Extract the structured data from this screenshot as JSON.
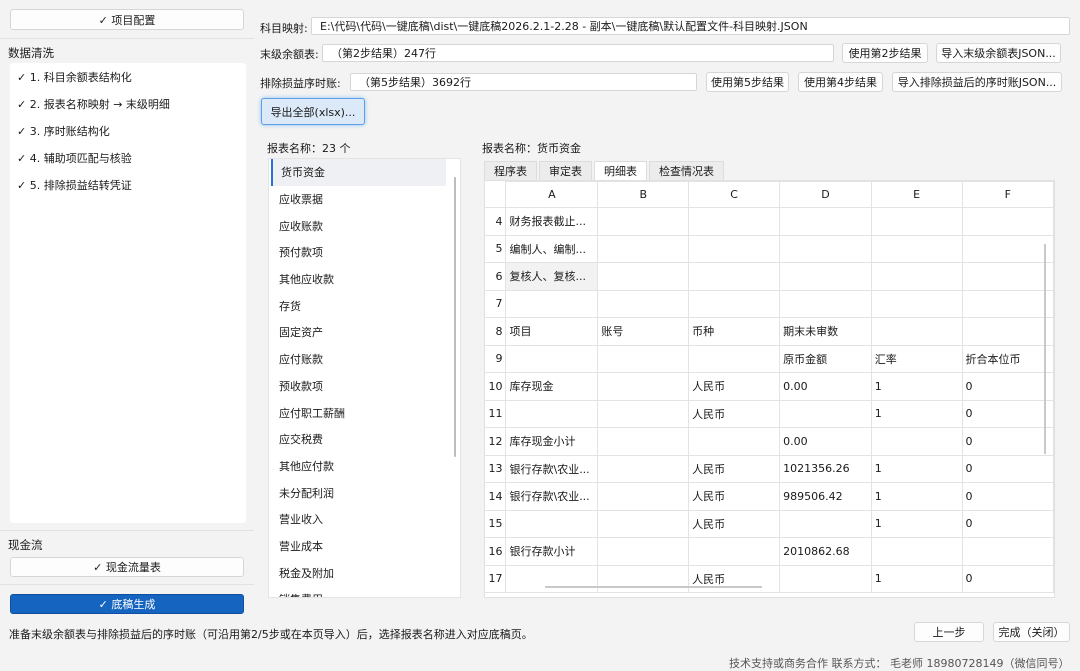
{
  "left": {
    "top_config": "✓ 项目配置",
    "data_clean_title": "数据清洗",
    "steps": [
      "✓ 1. 科目余额表结构化",
      "✓ 2. 报表名称映射 → 末级明细",
      "✓ 3. 序时账结构化",
      "✓ 4. 辅助项匹配与核验",
      "✓ 5. 排除损益结转凭证"
    ],
    "cash_title": "现金流",
    "cash_button": "✓ 现金流量表",
    "generate_button": "✓ 底稿生成"
  },
  "top": {
    "mapping_label": "科目映射:",
    "mapping_path": "E:\\代码\\代码\\一键底稿\\dist\\一键底稿2026.2.1-2.28 - 副本\\一键底稿\\默认配置文件-科目映射.JSON",
    "balance_label": "末级余额表:",
    "balance_value": "（第2步结果）247行",
    "use_step2": "使用第2步结果",
    "import_balance": "导入末级余额表JSON...",
    "journal_label": "排除损益序时账:",
    "journal_value": "（第5步结果）3692行",
    "use_step5": "使用第5步结果",
    "use_step4": "使用第4步结果",
    "import_journal": "导入排除损益后的序时账JSON...",
    "export_all": "导出全部(xlsx)..."
  },
  "report_list": {
    "title": "报表名称：23 个",
    "items": [
      "货币资金",
      "应收票据",
      "应收账款",
      "预付款项",
      "其他应收款",
      "存货",
      "固定资产",
      "应付账款",
      "预收款项",
      "应付职工薪酬",
      "应交税费",
      "其他应付款",
      "未分配利润",
      "营业收入",
      "营业成本",
      "税金及附加",
      "销售费用"
    ]
  },
  "sheet": {
    "title": "报表名称：货币资金",
    "tabs": [
      "程序表",
      "审定表",
      "明细表",
      "检查情况表"
    ],
    "active_tab": 2,
    "columns": [
      "A",
      "B",
      "C",
      "D",
      "E",
      "F"
    ],
    "rows": [
      {
        "n": "4",
        "cells": [
          "财务报表截止...",
          "",
          "",
          "",
          "",
          ""
        ]
      },
      {
        "n": "5",
        "cells": [
          "编制人、编制...",
          "",
          "",
          "",
          "",
          ""
        ]
      },
      {
        "n": "6",
        "cells": [
          "复核人、复核...",
          "",
          "",
          "",
          "",
          ""
        ]
      },
      {
        "n": "7",
        "cells": [
          "",
          "",
          "",
          "",
          "",
          ""
        ]
      },
      {
        "n": "8",
        "cells": [
          "项目",
          "账号",
          "币种",
          "期末未审数",
          "",
          ""
        ]
      },
      {
        "n": "9",
        "cells": [
          "",
          "",
          "",
          "原币金额",
          "汇率",
          "折合本位币"
        ]
      },
      {
        "n": "10",
        "cells": [
          "库存现金",
          "",
          "人民币",
          "0.00",
          "1",
          "0"
        ]
      },
      {
        "n": "11",
        "cells": [
          "",
          "",
          "人民币",
          "",
          "1",
          "0"
        ]
      },
      {
        "n": "12",
        "cells": [
          "库存现金小计",
          "",
          "",
          "0.00",
          "",
          "0"
        ]
      },
      {
        "n": "13",
        "cells": [
          "银行存款\\农业...",
          "",
          "人民币",
          "1021356.26",
          "1",
          "0"
        ]
      },
      {
        "n": "14",
        "cells": [
          "银行存款\\农业...",
          "",
          "人民币",
          "989506.42",
          "1",
          "0"
        ]
      },
      {
        "n": "15",
        "cells": [
          "",
          "",
          "人民币",
          "",
          "1",
          "0"
        ]
      },
      {
        "n": "16",
        "cells": [
          "银行存款小计",
          "",
          "",
          "2010862.68",
          "",
          ""
        ]
      },
      {
        "n": "17",
        "cells": [
          "",
          "",
          "人民币",
          "",
          "1",
          "0"
        ]
      }
    ]
  },
  "bottom": {
    "status": "准备末级余额表与排除损益后的序时账（可沿用第2/5步或在本页导入）后，选择报表名称进入对应底稿页。",
    "prev": "上一步",
    "done": "完成（关闭）",
    "support": "技术支持或商务合作 联系方式： 毛老师 18980728149（微信同号）"
  }
}
